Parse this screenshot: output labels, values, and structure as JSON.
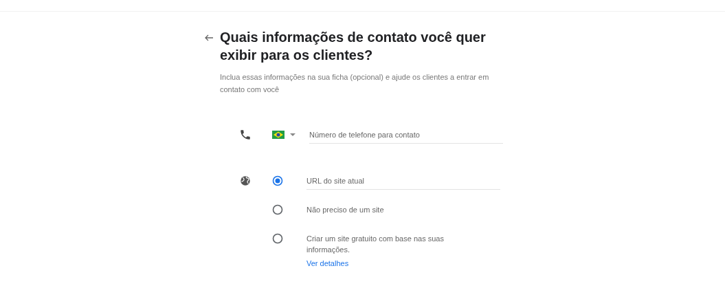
{
  "header": {
    "title": "Quais informações de contato você quer exibir para os clientes?",
    "subtitle": "Inclua essas informações na sua ficha (opcional) e ajude os clientes a entrar em contato com você"
  },
  "phone": {
    "placeholder": "Número de telefone para contato"
  },
  "website": {
    "options": [
      {
        "kind": "field",
        "placeholder": "URL do site atual",
        "selected": true
      },
      {
        "kind": "text",
        "label": "Não preciso de um site",
        "selected": false
      },
      {
        "kind": "text",
        "label": "Criar um site gratuito com base nas suas informações.",
        "link": "Ver detalhes",
        "selected": false
      }
    ]
  }
}
